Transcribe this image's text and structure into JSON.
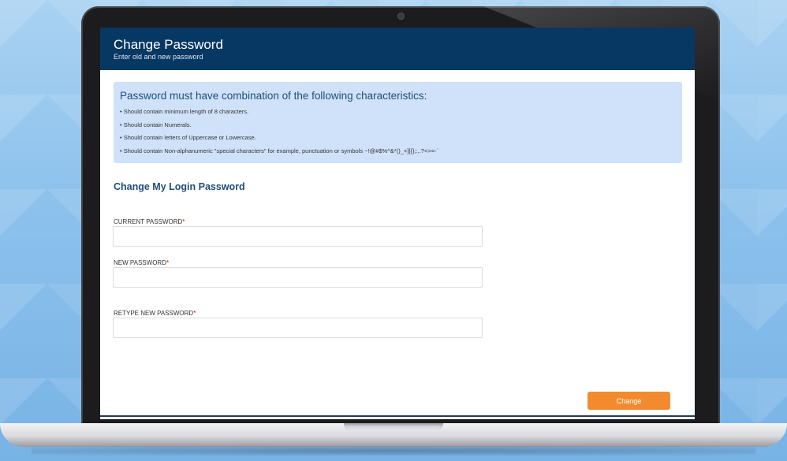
{
  "header": {
    "title": "Change Password",
    "subtitle": "Enter old and new password"
  },
  "rules": {
    "title": "Password must have combination of the following characteristics:",
    "items": [
      "Should contain minimum length of 8 characters.",
      "Should contain Numerals.",
      "Should contain letters of Uppercase or Lowercase.",
      "Should contain Non-alphanumeric \"special characters\" for example, punctuation or symbols ~!@#$%^&*()_+][{};:,.?<>=-`"
    ]
  },
  "form": {
    "section_title": "Change My Login Password",
    "current_password_label": "CURRENT PASSWORD",
    "new_password_label": "NEW PASSWORD",
    "retype_password_label": "RETYPE NEW PASSWORD",
    "required_marker": "*",
    "change_label": "Change"
  },
  "colors": {
    "header_bg": "#073763",
    "info_box_bg": "#cfe2f9",
    "accent_button": "#f38b2e",
    "required": "#cc0000"
  }
}
